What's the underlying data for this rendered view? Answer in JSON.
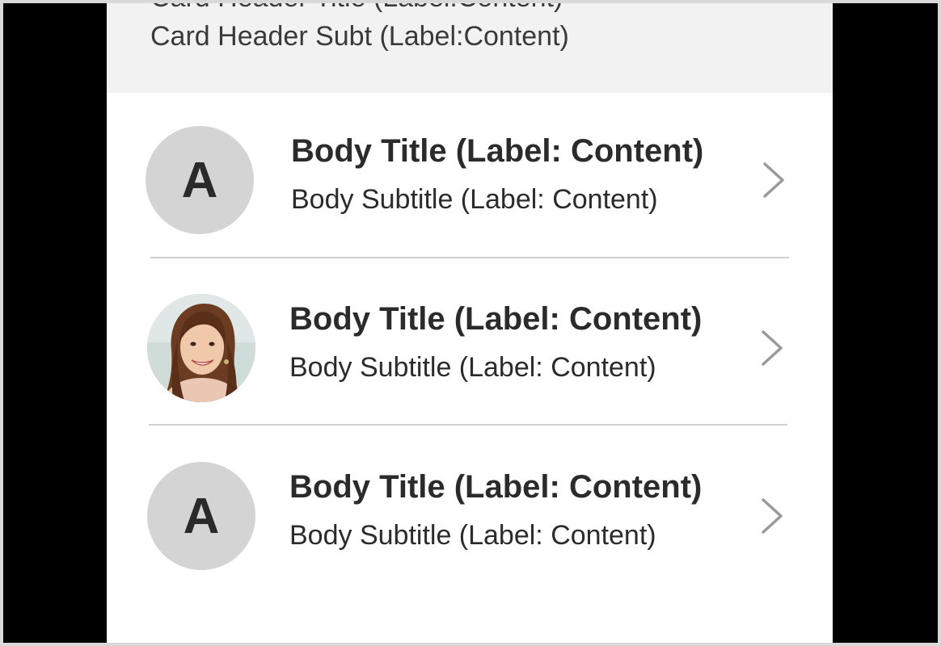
{
  "header": {
    "title": "Card Header Title (Label:Content)",
    "subtitle": "Card Header Subt (Label:Content)"
  },
  "rows": [
    {
      "avatar_type": "initial",
      "initial": "A",
      "title": "Body Title (Label: Content)",
      "subtitle": "Body Subtitle (Label: Content)",
      "chevron_icon": "chevron-right-icon"
    },
    {
      "avatar_type": "photo",
      "title": "Body Title (Label: Content)",
      "subtitle": "Body Subtitle (Label: Content)",
      "chevron_icon": "chevron-right-icon"
    },
    {
      "avatar_type": "initial",
      "initial": "A",
      "title": "Body Title (Label: Content)",
      "subtitle": "Body Subtitle (Label: Content)",
      "chevron_icon": "chevron-right-icon"
    }
  ],
  "colors": {
    "background_frame": "#000000",
    "card_background": "#ffffff",
    "header_background": "#f2f2f2",
    "avatar_background": "#d4d4d4",
    "divider": "#d0d0d0",
    "chevron": "#9a9a9a",
    "text": "#2b2b2b"
  }
}
